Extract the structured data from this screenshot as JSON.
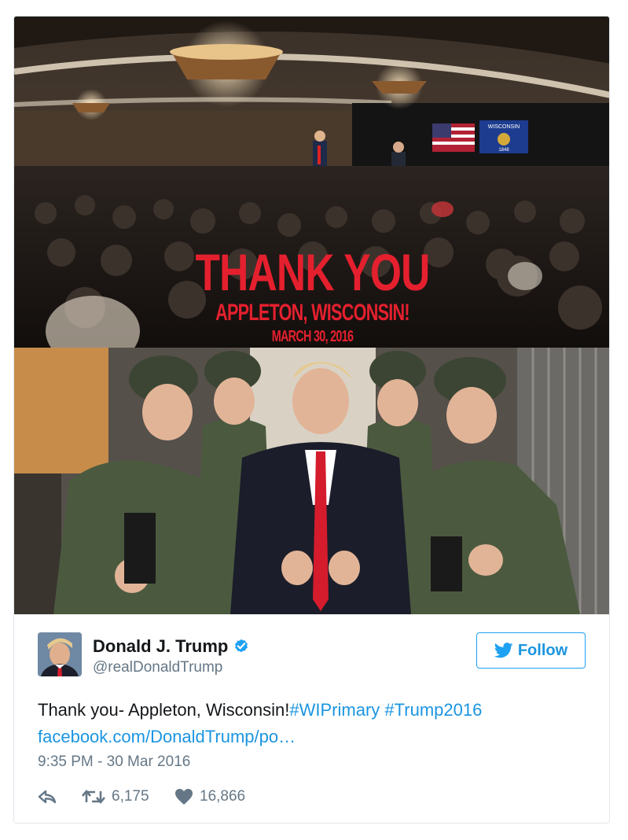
{
  "image_overlay": {
    "line1": "THANK YOU",
    "line2": "APPLETON, WISCONSIN!",
    "line3": "MARCH 30, 2016",
    "banner": "WISCONSIN",
    "banner_year": "1848"
  },
  "author": {
    "name": "Donald J. Trump",
    "handle": "@realDonaldTrump",
    "verified": true
  },
  "follow_button": {
    "label": "Follow"
  },
  "tweet": {
    "text_plain": "Thank you- Appleton, Wisconsin!",
    "hashtag1": "#WIPrimary",
    "hashtag2": "#Trump2016",
    "link": "facebook.com/DonaldTrump/po…",
    "timestamp": "9:35 PM - 30 Mar 2016"
  },
  "actions": {
    "retweets": "6,175",
    "likes": "16,866"
  },
  "colors": {
    "accent": "#1da1f2",
    "link": "#1b95e0",
    "overlay_red": "#e5202e",
    "muted": "#657786"
  },
  "icons": [
    "reply-icon",
    "retweet-icon",
    "heart-icon",
    "verified-icon",
    "twitter-bird-icon"
  ]
}
